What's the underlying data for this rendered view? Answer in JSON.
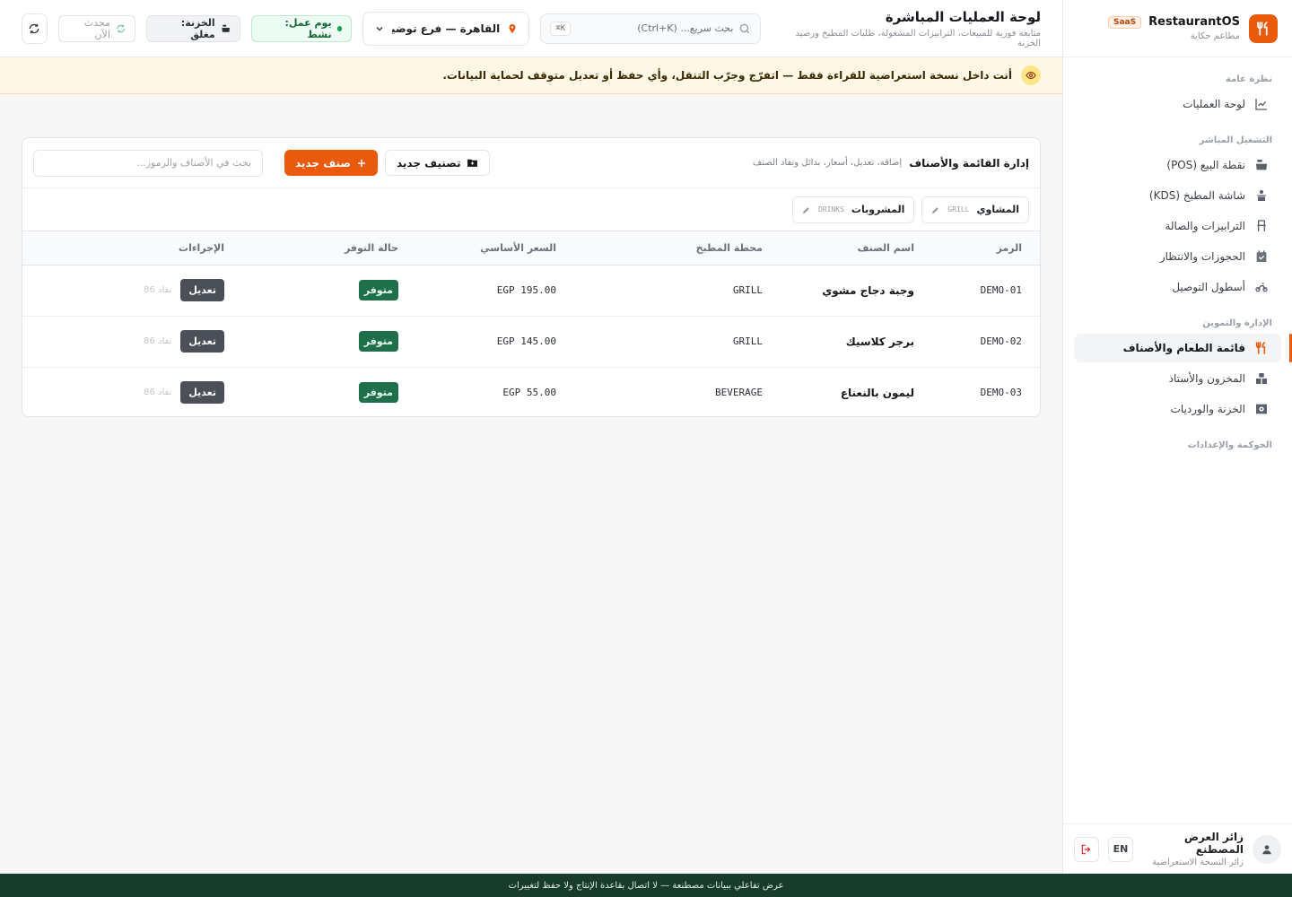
{
  "brand": {
    "name": "RestaurantOS",
    "badge": "SaaS",
    "subtitle": "مطاعم حكاية"
  },
  "sidebar": {
    "groups": [
      {
        "title": "نظرة عامة",
        "items": [
          {
            "label": "لوحة العمليات",
            "icon": "chart-line-icon",
            "active": false
          }
        ]
      },
      {
        "title": "التشغيل المباشر",
        "items": [
          {
            "label": "نقطة البيع (POS)",
            "icon": "cash-register-icon",
            "active": false
          },
          {
            "label": "شاشة المطبخ (KDS)",
            "icon": "kitchen-icon",
            "active": false
          },
          {
            "label": "الترابيزات والصالة",
            "icon": "chair-icon",
            "active": false
          },
          {
            "label": "الحجوزات والانتظار",
            "icon": "calendar-icon",
            "active": false
          },
          {
            "label": "أسطول التوصيل",
            "icon": "motorbike-icon",
            "active": false
          }
        ]
      },
      {
        "title": "الإدارة والتموين",
        "items": [
          {
            "label": "قائمة الطعام والأصناف",
            "icon": "utensils-icon",
            "active": true
          },
          {
            "label": "المخزون والأستاذ",
            "icon": "boxes-icon",
            "active": false
          },
          {
            "label": "الخزنة والورديات",
            "icon": "safe-icon",
            "active": false
          }
        ]
      },
      {
        "title": "الحوكمة والإعدادات",
        "items": []
      }
    ]
  },
  "user": {
    "name": "زائر العرض المصطنع",
    "role": "زائر النسخة الاستعراضية",
    "lang_button": "EN"
  },
  "header": {
    "title": "لوحة العمليات المباشرة",
    "subtitle": "متابعة فورية للمبيعات، الترابيزات المشغولة، طلبات المطبخ ورصيد الخزنة",
    "search_placeholder": "بحث سريع... (Ctrl+K)",
    "search_shortcut": "K⌘",
    "branch": "القاهرة — فرع توضيـ...",
    "workday_status": "يوم عمل: نشط",
    "cashbox_status": "الخزنة: مغلق",
    "updated_label": "محدث الآن"
  },
  "banner": {
    "text": "أنت داخل نسخة استعراضية للقراءة فقط — اتفرّج وجرّب التنقل، وأي حفظ أو تعديل متوقف لحماية البيانات."
  },
  "menu_card": {
    "title": "إدارة القائمة والأصناف",
    "subtitle": "إضافة، تعديل، أسعار، بدائل ونفاد الصنف",
    "new_category_button": "تصنيف جديد",
    "new_item_button": "صنف جديد",
    "search_placeholder": "بحث في الأصناف والرموز...",
    "categories": [
      {
        "name": "المشاوي",
        "code": "GRILL"
      },
      {
        "name": "المشروبات",
        "code": "DRINKS"
      }
    ],
    "columns": [
      "الرمز",
      "اسم الصنف",
      "محطة المطبخ",
      "السعر الأساسي",
      "حالة التوفر",
      "الإجراءات"
    ],
    "rows": [
      {
        "code": "DEMO-01",
        "name": "وجبة دجاج مشوي",
        "station": "GRILL",
        "price": "EGP 195.00",
        "status": "متوفر",
        "edit": "تعديل",
        "sold_out": "نفاد 86"
      },
      {
        "code": "DEMO-02",
        "name": "برجر كلاسيك",
        "station": "GRILL",
        "price": "EGP 145.00",
        "status": "متوفر",
        "edit": "تعديل",
        "sold_out": "نفاد 86"
      },
      {
        "code": "DEMO-03",
        "name": "ليمون بالنعناع",
        "station": "BEVERAGE",
        "price": "EGP 55.00",
        "status": "متوفر",
        "edit": "تعديل",
        "sold_out": "نفاد 86"
      }
    ]
  },
  "footer": {
    "text": "عرض تفاعلي ببيانات مصطنعة — لا اتصال بقاعدة الإنتاج ولا حفظ لتغييرات"
  },
  "colors": {
    "accent": "#ea5a0c",
    "available_badge": "#1f6f4a",
    "footer_bg": "#173b2c",
    "banner_bg": "#fff8e6"
  }
}
